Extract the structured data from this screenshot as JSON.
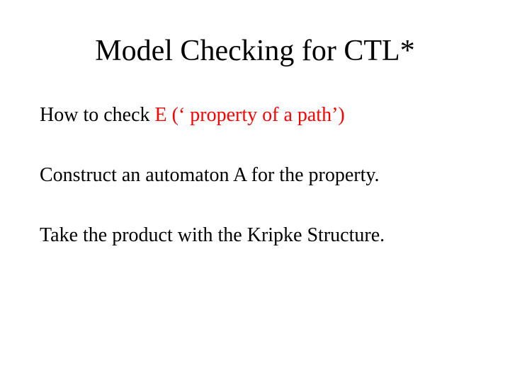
{
  "title": "Model Checking for CTL*",
  "line1_a": "How to check ",
  "line1_b": "E (‘ property of a path’)",
  "line2": "Construct an automaton A for the property.",
  "line3": "Take the product with the Kripke Structure."
}
